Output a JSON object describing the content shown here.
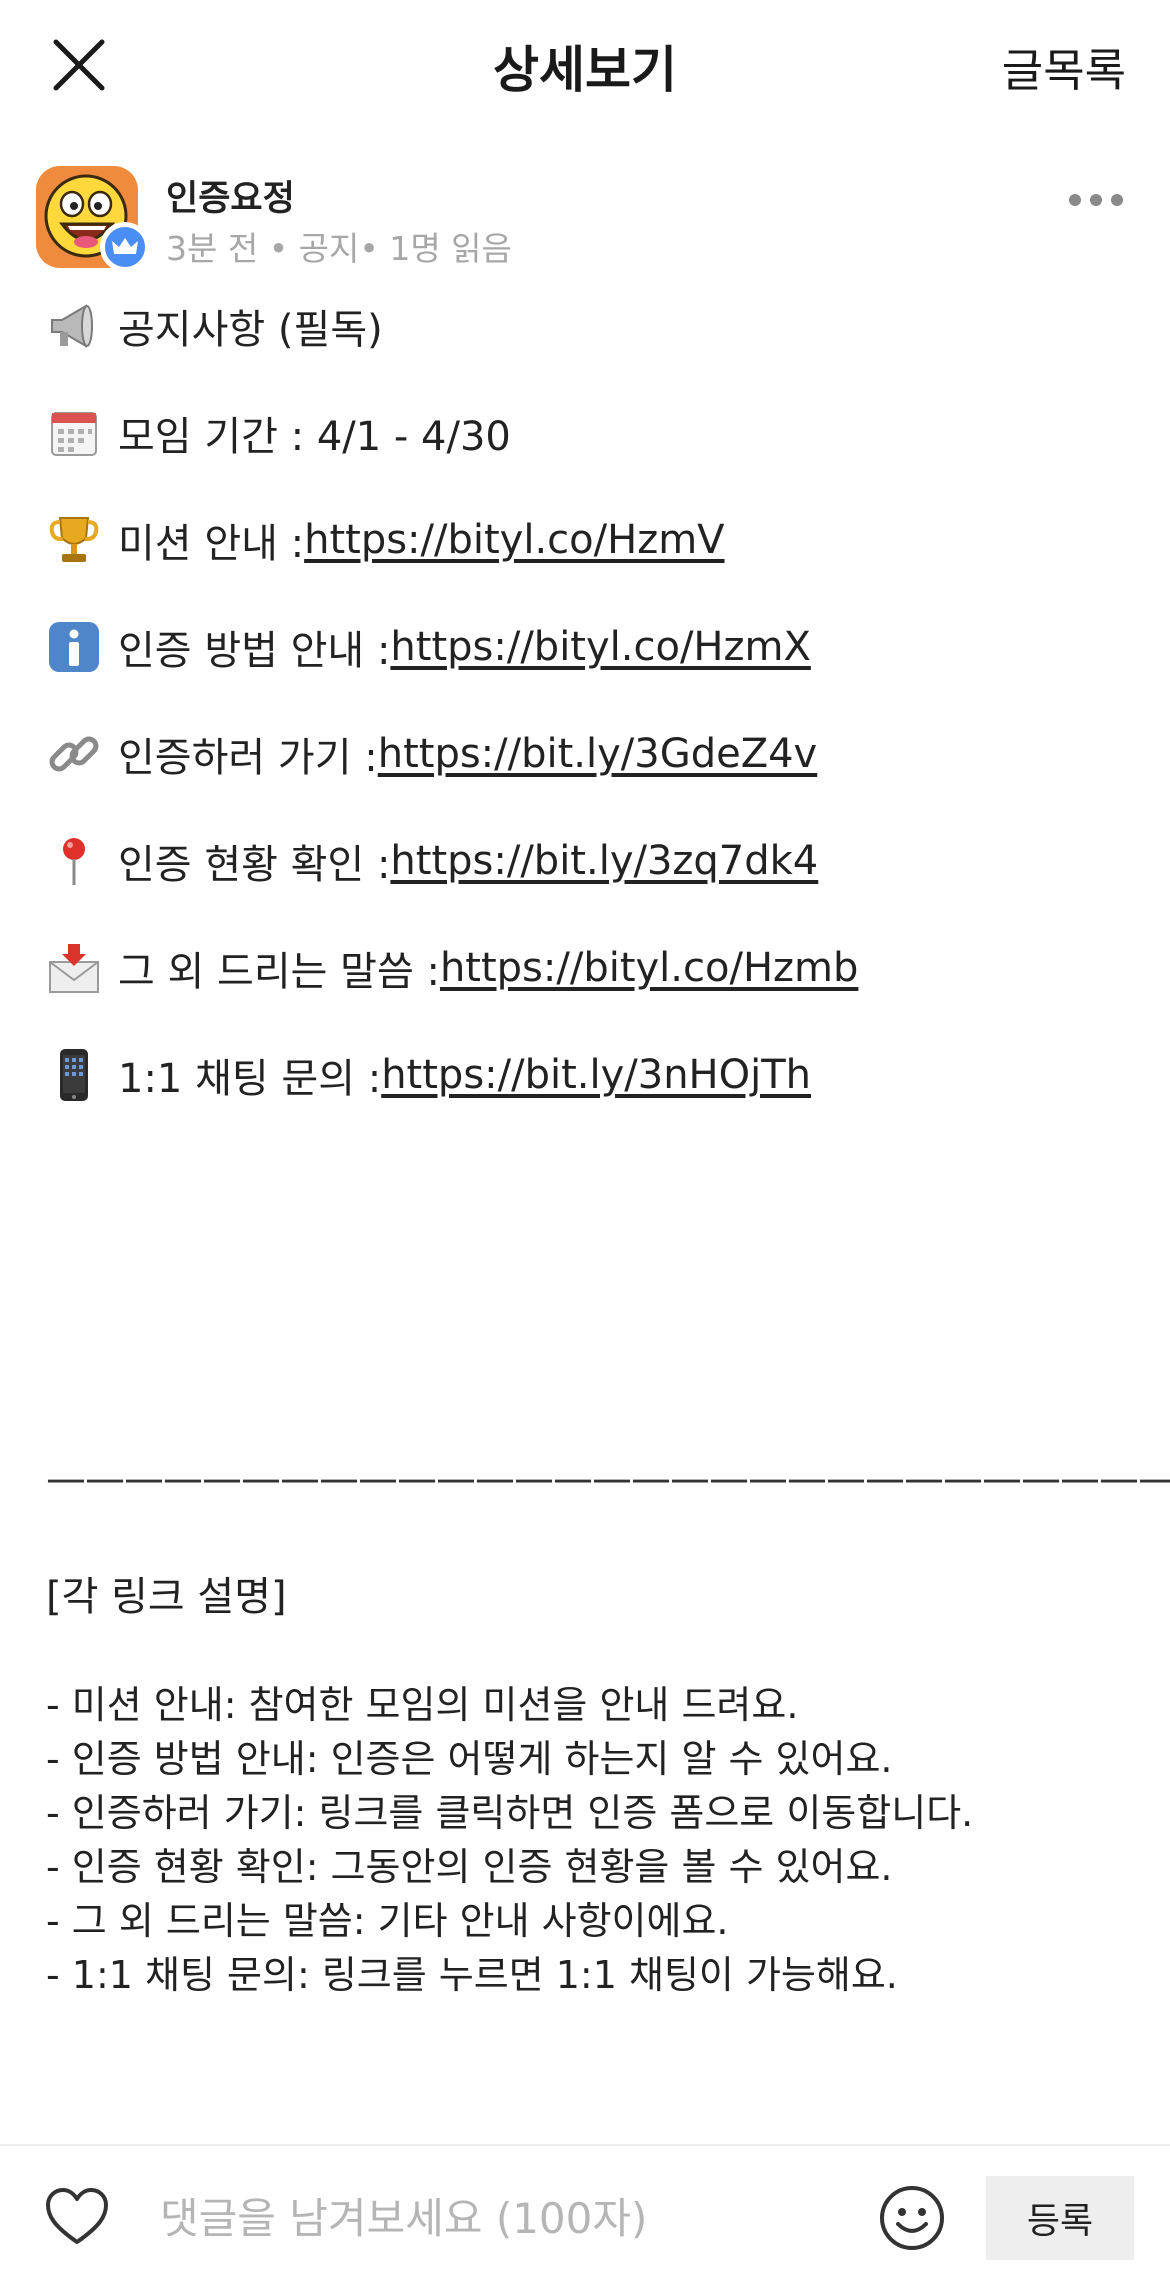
{
  "header": {
    "title": "상세보기",
    "list_label": "글목록"
  },
  "post": {
    "author": "인증요정",
    "meta": "3분 전 • 공지• 1명 읽음"
  },
  "items": [
    {
      "icon": "megaphone-icon",
      "text": "공지사항 (필독)",
      "link": ""
    },
    {
      "icon": "calendar-icon",
      "text": "모임 기간 : 4/1 - 4/30",
      "link": ""
    },
    {
      "icon": "trophy-icon",
      "text": "미션 안내 : ",
      "link": "https://bityl.co/HzmV"
    },
    {
      "icon": "info-icon",
      "text": "인증 방법 안내 : ",
      "link": "https://bityl.co/HzmX"
    },
    {
      "icon": "link-icon",
      "text": "인증하러 가기 : ",
      "link": "https://bit.ly/3GdeZ4v"
    },
    {
      "icon": "pin-icon",
      "text": "인증 현황 확인 : ",
      "link": "https://bit.ly/3zq7dk4"
    },
    {
      "icon": "envelope-icon",
      "text": " 그 외 드리는 말씀 : ",
      "link": "https://bityl.co/Hzmb"
    },
    {
      "icon": "phone-icon",
      "text": "1:1 채팅 문의 : ",
      "link": "https://bit.ly/3nHOjTh"
    }
  ],
  "divider": "——————————————————————————————",
  "section_title": "[각 링크 설명]",
  "descriptions": [
    "- 미션 안내: 참여한 모임의 미션을 안내 드려요.",
    "- 인증 방법 안내: 인증은 어떻게 하는지 알 수 있어요.",
    "- 인증하러 가기: 링크를 클릭하면 인증 폼으로 이동합니다.",
    "- 인증 현황 확인: 그동안의 인증 현황을 볼 수 있어요.",
    "- 그 외 드리는 말씀: 기타 안내 사항이에요.",
    "- 1:1 채팅 문의: 링크를 누르면 1:1 채팅이 가능해요."
  ],
  "comment": {
    "placeholder": "댓글을 남겨보세요 (100자)",
    "submit_label": "등록"
  },
  "colors": {
    "avatar_bg": "#f08a3c",
    "badge_blue": "#4a8ef5",
    "meta_gray": "#a7a7a7"
  }
}
